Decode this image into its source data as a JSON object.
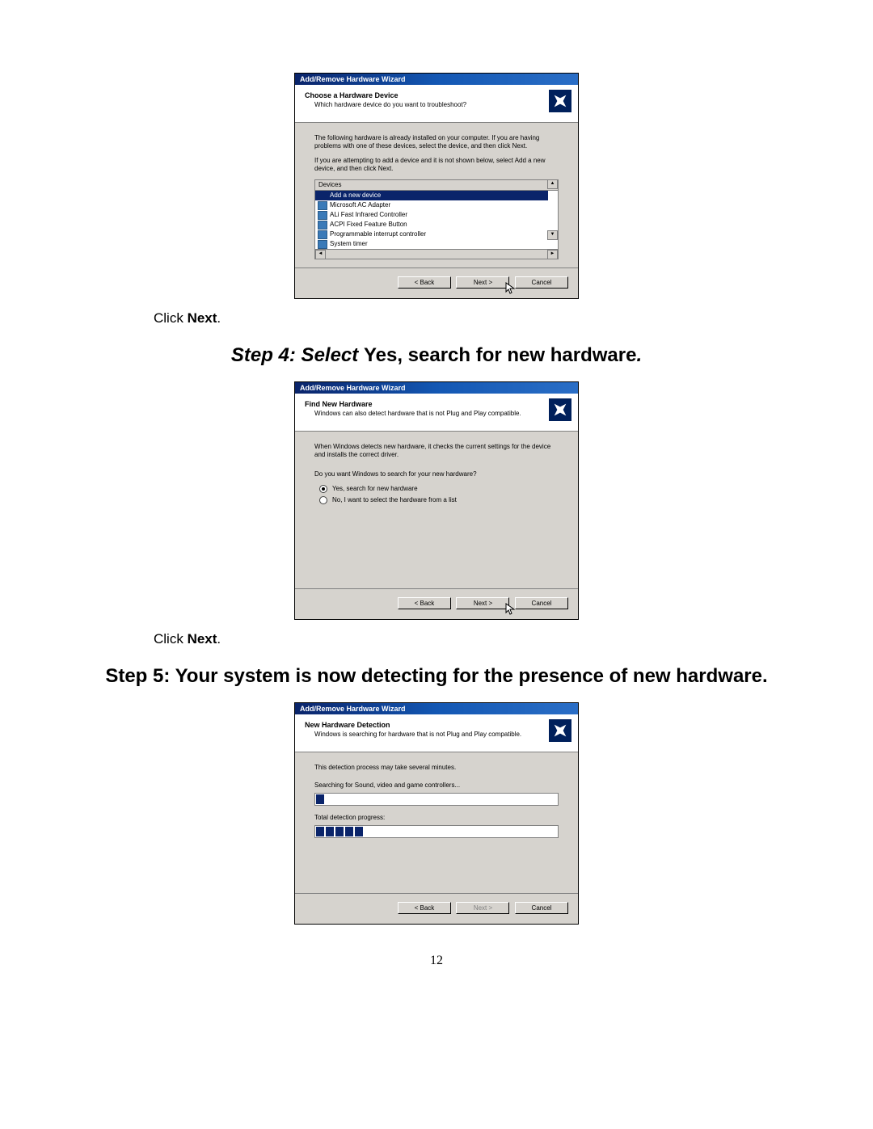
{
  "dialog1": {
    "title": "Add/Remove Hardware Wizard",
    "h_title": "Choose a Hardware Device",
    "h_sub": "Which hardware device do you want to troubleshoot?",
    "p1": "The following hardware is already installed on your computer. If you are having problems with one of these devices, select the device, and then click Next.",
    "p2": "If you are attempting to add a device and it is not shown below, select Add a new device, and then click Next.",
    "list_header": "Devices",
    "items": {
      "i0": "Add a new device",
      "i1": "Microsoft AC Adapter",
      "i2": "ALi Fast Infrared Controller",
      "i3": "ACPI Fixed Feature Button",
      "i4": "Programmable interrupt controller",
      "i5": "System timer"
    },
    "back": "< Back",
    "next": "Next >",
    "cancel": "Cancel"
  },
  "instr1a": "Click ",
  "instr1b": "Next",
  "instr1c": ".",
  "step4a": "Step 4: Select ",
  "step4b": "Yes, search for new hardware",
  "step4c": ".",
  "dialog2": {
    "title": "Add/Remove Hardware Wizard",
    "h_title": "Find New Hardware",
    "h_sub": "Windows can also detect hardware that is not Plug and Play compatible.",
    "p1": "When Windows detects new hardware, it checks the current settings for the device and installs the correct driver.",
    "q": "Do you want Windows to search for your new hardware?",
    "r1": "Yes, search for new hardware",
    "r2": "No, I want to select the hardware from a list",
    "back": "< Back",
    "next": "Next >",
    "cancel": "Cancel"
  },
  "instr2a": "Click ",
  "instr2b": "Next",
  "instr2c": ".",
  "step5": "Step 5: Your system is now detecting for the presence of new hardware.",
  "dialog3": {
    "title": "Add/Remove Hardware Wizard",
    "h_title": "New Hardware Detection",
    "h_sub": "Windows is searching for hardware that  is not Plug and Play compatible.",
    "p1": "This detection process may take several minutes.",
    "p2": "Searching for Sound, video and game controllers...",
    "p3": "Total detection progress:",
    "back": "< Back",
    "next": "Next >",
    "cancel": "Cancel"
  },
  "pagenum": "12"
}
